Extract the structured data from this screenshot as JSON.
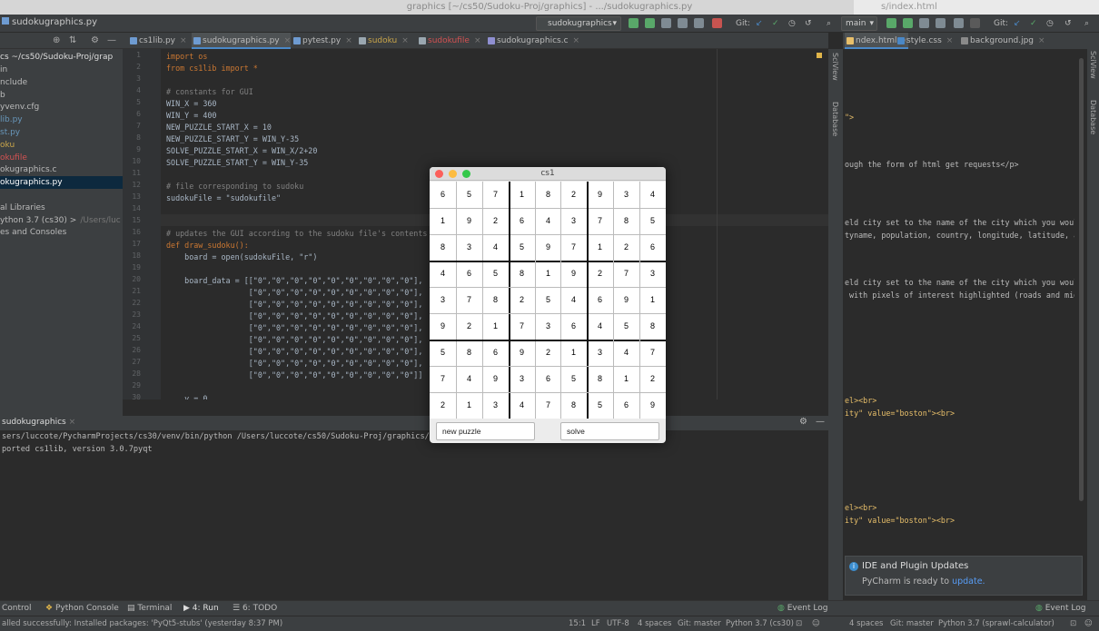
{
  "window": {
    "title": "graphics [~/cs50/Sudoku-Proj/graphics] - .../sudokugraphics.py",
    "right_title": "s/index.html"
  },
  "navbar": {
    "breadcrumb": "sudokugraphics.py",
    "run_config": "sudokugraphics",
    "branch": "main",
    "git_label": "Git:",
    "git_label2": "Git:"
  },
  "project": {
    "header_path": "cs ~/cs50/Sudoku-Proj/grap",
    "items": [
      {
        "label": "in",
        "color": "#bbbbbb"
      },
      {
        "label": "nclude",
        "color": "#bbbbbb"
      },
      {
        "label": "b",
        "color": "#bbbbbb"
      },
      {
        "label": "yvenv.cfg",
        "color": "#bbbbbb"
      },
      {
        "label": "lib.py",
        "color": "#6897bb"
      },
      {
        "label": "st.py",
        "color": "#6897bb"
      },
      {
        "label": "oku",
        "color": "#c9a54a"
      },
      {
        "label": "okufile",
        "color": "#d25252"
      },
      {
        "label": "okugraphics.c",
        "color": "#bbbbbb"
      },
      {
        "label": "okugraphics.py",
        "color": "#ffffff"
      },
      {
        "label": "",
        "color": "#bbbbbb"
      },
      {
        "label": "al Libraries",
        "color": "#bbbbbb"
      },
      {
        "label": "ython 3.7 (cs30) >",
        "color": "#bbbbbb",
        "suffix": "/Users/luc"
      },
      {
        "label": "es and Consoles",
        "color": "#bbbbbb"
      }
    ]
  },
  "editor_tabs": [
    {
      "label": "cs1lib.py",
      "active": false
    },
    {
      "label": "sudokugraphics.py",
      "active": true
    },
    {
      "label": "pytest.py",
      "active": false
    },
    {
      "label": "sudoku",
      "active": false
    },
    {
      "label": "sudokufile",
      "active": false
    },
    {
      "label": "sudokugraphics.c",
      "active": false
    }
  ],
  "right_tabs": [
    {
      "label": "ndex.html"
    },
    {
      "label": "style.css"
    },
    {
      "label": "background.jpg"
    }
  ],
  "code_lines": [
    "import os",
    "from cs1lib import *",
    "",
    "# constants for GUI",
    "WIN_X = 360",
    "WIN_Y = 400",
    "NEW_PUZZLE_START_X = 10",
    "NEW_PUZZLE_START_Y = WIN_Y-35",
    "SOLVE_PUZZLE_START_X = WIN_X/2+20",
    "SOLVE_PUZZLE_START_Y = WIN_Y-35",
    "",
    "# file corresponding to sudoku",
    "sudokuFile = \"sudokufile\"",
    "",
    "",
    "# updates the GUI according to the sudoku file's contents",
    "def draw_sudoku():",
    "    board = open(sudokuFile, \"r\")",
    "",
    "    board_data = [[\"0\",\"0\",\"0\",\"0\",\"0\",\"0\",\"0\",\"0\",\"0\"],",
    "                  [\"0\",\"0\",\"0\",\"0\",\"0\",\"0\",\"0\",\"0\",\"0\"],",
    "                  [\"0\",\"0\",\"0\",\"0\",\"0\",\"0\",\"0\",\"0\",\"0\"],",
    "                  [\"0\",\"0\",\"0\",\"0\",\"0\",\"0\",\"0\",\"0\",\"0\"],",
    "                  [\"0\",\"0\",\"0\",\"0\",\"0\",\"0\",\"0\",\"0\",\"0\"],",
    "                  [\"0\",\"0\",\"0\",\"0\",\"0\",\"0\",\"0\",\"0\",\"0\"],",
    "                  [\"0\",\"0\",\"0\",\"0\",\"0\",\"0\",\"0\",\"0\",\"0\"],",
    "                  [\"0\",\"0\",\"0\",\"0\",\"0\",\"0\",\"0\",\"0\",\"0\"],",
    "                  [\"0\",\"0\",\"0\",\"0\",\"0\",\"0\",\"0\",\"0\",\"0\"]]",
    "",
    "    y = 0"
  ],
  "html_lines": [
    {
      "text": "\">",
      "color": "#e8bf6a"
    },
    {
      "text": "ough the form of html get requests</p>",
      "color": "#bbbbbb"
    },
    {
      "text": "eld city set to the name of the city which you would",
      "color": "#bbbbbb"
    },
    {
      "text": "tyname, population, country, longitude, latitude, and",
      "color": "#bbbbbb"
    },
    {
      "text": "eld city set to the name of the city which you would",
      "color": "#bbbbbb"
    },
    {
      "text": " with pixels of interest highlighted (roads and mid-h",
      "color": "#bbbbbb"
    },
    {
      "text": "el><br>",
      "color": "#e8bf6a"
    },
    {
      "text": "ity\" value=\"boston\"><br>",
      "color": "#e8bf6a"
    },
    {
      "text": "el><br>",
      "color": "#e8bf6a"
    },
    {
      "text": "ity\" value=\"boston\"><br>",
      "color": "#e8bf6a"
    }
  ],
  "run": {
    "tab_label": "sudokugraphics",
    "lines": [
      "sers/luccote/PycharmProjects/cs30/venv/bin/python /Users/luccote/cs50/Sudoku-Proj/graphics/sudokugraphics.py",
      "ported cs1lib, version 3.0.7pyqt"
    ]
  },
  "gui": {
    "title": "cs1",
    "new_puzzle_label": "new puzzle",
    "solve_label": "solve",
    "board": [
      [
        "6",
        "5",
        "7",
        "1",
        "8",
        "2",
        "9",
        "3",
        "4"
      ],
      [
        "1",
        "9",
        "2",
        "6",
        "4",
        "3",
        "7",
        "8",
        "5"
      ],
      [
        "8",
        "3",
        "4",
        "5",
        "9",
        "7",
        "1",
        "2",
        "6"
      ],
      [
        "4",
        "6",
        "5",
        "8",
        "1",
        "9",
        "2",
        "7",
        "3"
      ],
      [
        "3",
        "7",
        "8",
        "2",
        "5",
        "4",
        "6",
        "9",
        "1"
      ],
      [
        "9",
        "2",
        "1",
        "7",
        "3",
        "6",
        "4",
        "5",
        "8"
      ],
      [
        "5",
        "8",
        "6",
        "9",
        "2",
        "1",
        "3",
        "4",
        "7"
      ],
      [
        "7",
        "4",
        "9",
        "3",
        "6",
        "5",
        "8",
        "1",
        "2"
      ],
      [
        "2",
        "1",
        "3",
        "4",
        "7",
        "8",
        "5",
        "6",
        "9"
      ]
    ]
  },
  "bottom_tabs": {
    "version_control": "Control",
    "python_console": "Python Console",
    "terminal": "Terminal",
    "run": "4: Run",
    "todo": "6: TODO",
    "event_log": "Event Log",
    "event_log_right": "Event Log"
  },
  "status": {
    "message": "alled successfully: Installed packages: 'PyQt5-stubs' (yesterday 8:37 PM)",
    "position": "15:1",
    "line_sep": "LF",
    "encoding": "UTF-8",
    "indent": "4 spaces",
    "git": "Git: master",
    "interpreter": "Python 3.7 (cs30)",
    "indent_right": "4 spaces",
    "git_right": "Git: master",
    "interpreter_right": "Python 3.7 (sprawl-calculator)"
  },
  "notification": {
    "title": "IDE and Plugin Updates",
    "body": "PyCharm is ready to",
    "link": "update."
  },
  "side_labels": {
    "sciview": "SciView",
    "database": "Database"
  }
}
